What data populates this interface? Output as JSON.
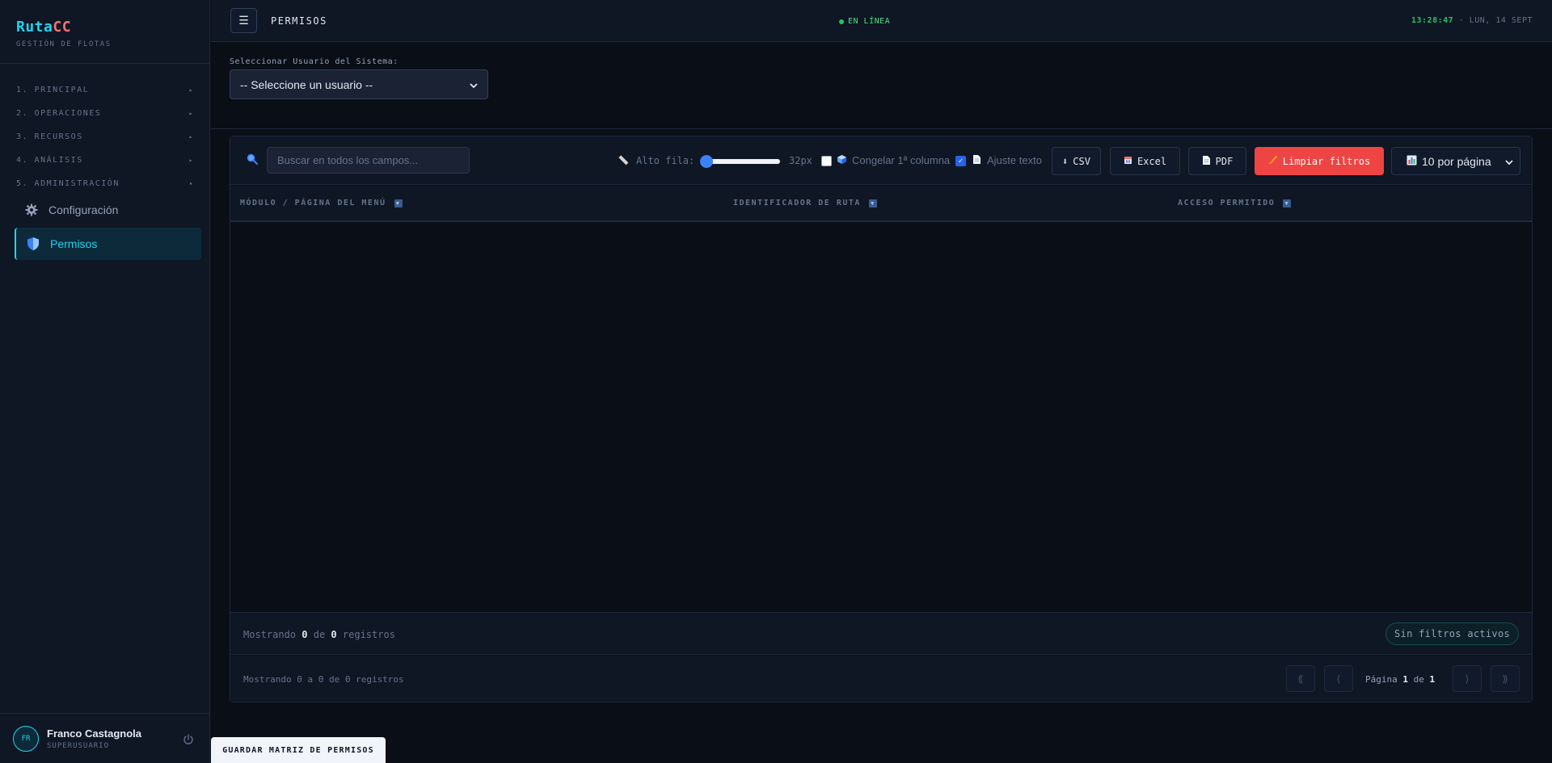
{
  "brand": {
    "name_part1": "Ruta",
    "name_part2": "CC",
    "subtitle": "GESTIÓN DE FLOTAS"
  },
  "sidebar": {
    "sections": [
      {
        "label": "1. PRINCIPAL",
        "arrow": "▸"
      },
      {
        "label": "2. OPERACIONES",
        "arrow": "▸"
      },
      {
        "label": "3. RECURSOS",
        "arrow": "▸"
      },
      {
        "label": "4. ANÁLISIS",
        "arrow": "▸"
      },
      {
        "label": "5. ADMINISTRACIÓN",
        "arrow": "▾"
      }
    ],
    "items": [
      {
        "label": "Configuración",
        "icon": "gear-icon",
        "active": false
      },
      {
        "label": "Permisos",
        "icon": "shield-icon",
        "active": true
      }
    ]
  },
  "user": {
    "initials": "FR",
    "name": "Franco Castagnola",
    "role": "SUPERUSUARIO"
  },
  "topbar": {
    "title": "PERMISOS",
    "status": "EN LÍNEA",
    "time": "13:28:47",
    "separator": "·",
    "date": "LUN, 14 SEPT"
  },
  "user_select": {
    "label": "Seleccionar Usuario del Sistema:",
    "value": "-- Seleccione un usuario --"
  },
  "toolbar": {
    "search_placeholder": "Buscar en todos los campos...",
    "row_height_label": "Alto fila:",
    "row_height_value": "32px",
    "row_height_fraction": 0.05,
    "freeze_label": "Congelar 1ª columna",
    "freeze_checked": false,
    "wrap_label": "Ajuste texto",
    "wrap_checked": true,
    "csv_label": "CSV",
    "excel_label": "Excel",
    "pdf_label": "PDF",
    "clear_label": "Limpiar filtros",
    "per_page": "10 por página"
  },
  "table": {
    "columns": [
      "MÓDULO / PÁGINA DEL MENÚ",
      "IDENTIFICADOR DE RUTA",
      "ACCESO PERMITIDO"
    ],
    "rows": []
  },
  "summary": {
    "prefix": "Mostrando",
    "shown": "0",
    "of": "de",
    "total": "0",
    "suffix": "registros",
    "filters_badge": "Sin filtros activos"
  },
  "pager": {
    "range_text": "Mostrando 0 a 0 de 0 registros",
    "first": "⟪",
    "prev": "⟨",
    "next": "⟩",
    "last": "⟫",
    "page_prefix": "Página",
    "page": "1",
    "page_of": "de",
    "pages": "1"
  },
  "footer": {
    "save_label": "GUARDAR MATRIZ DE PERMISOS"
  },
  "colors": {
    "accent": "#22d3ee",
    "brand_red": "#f87171",
    "online": "#22c55e",
    "danger": "#ef4444"
  }
}
